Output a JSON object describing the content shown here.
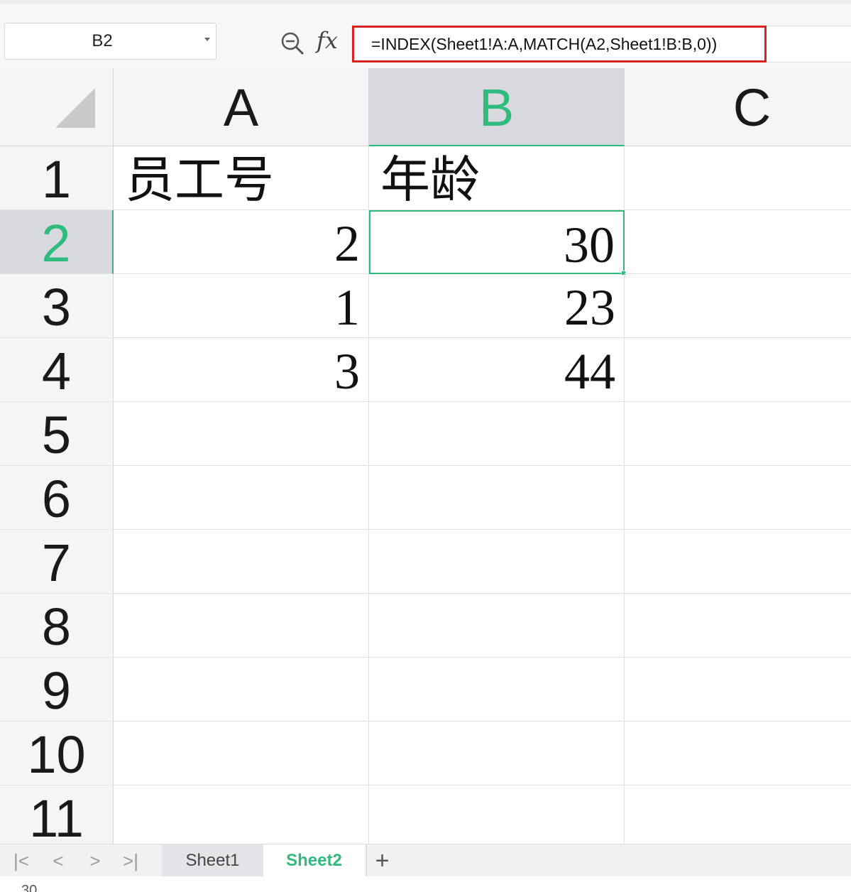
{
  "formula_bar": {
    "name_box": "B2",
    "formula": "=INDEX(Sheet1!A:A,MATCH(A2,Sheet1!B:B,0))"
  },
  "columns": [
    {
      "label": "A",
      "active": false
    },
    {
      "label": "B",
      "active": true
    },
    {
      "label": "C",
      "active": false
    }
  ],
  "rows": [
    {
      "label": "1",
      "cells": [
        "员工号",
        "年龄",
        ""
      ]
    },
    {
      "label": "2",
      "cells": [
        "2",
        "30",
        ""
      ]
    },
    {
      "label": "3",
      "cells": [
        "1",
        "23",
        ""
      ]
    },
    {
      "label": "4",
      "cells": [
        "3",
        "44",
        ""
      ]
    },
    {
      "label": "5",
      "cells": [
        "",
        "",
        ""
      ]
    },
    {
      "label": "6",
      "cells": [
        "",
        "",
        ""
      ]
    },
    {
      "label": "7",
      "cells": [
        "",
        "",
        ""
      ]
    },
    {
      "label": "8",
      "cells": [
        "",
        "",
        ""
      ]
    },
    {
      "label": "9",
      "cells": [
        "",
        "",
        ""
      ]
    },
    {
      "label": "10",
      "cells": [
        "",
        "",
        ""
      ]
    },
    {
      "label": "11",
      "cells": [
        "",
        "",
        ""
      ]
    }
  ],
  "selected_cell": {
    "row": 2,
    "col": "B"
  },
  "tabs": {
    "nav": [
      "|<",
      "<",
      ">",
      ">|"
    ],
    "sheets": [
      {
        "label": "Sheet1",
        "active": false
      },
      {
        "label": "Sheet2",
        "active": true
      }
    ],
    "add_label": "+"
  },
  "status": {
    "text": "30"
  },
  "colors": {
    "accent": "#2fbb7e",
    "formula_highlight": "#d9231c"
  },
  "icons": {
    "zoom": "zoom-out-icon",
    "fx": "fx-icon",
    "name_box_caret": "caret-down-icon"
  }
}
